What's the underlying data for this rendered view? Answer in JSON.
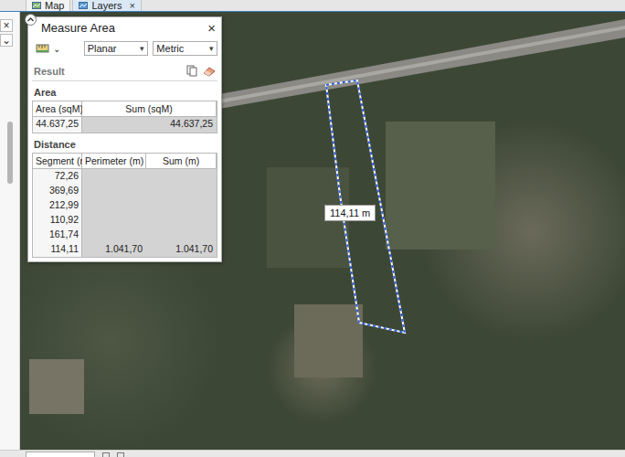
{
  "tabs": [
    {
      "label": "Map",
      "selected": false,
      "close": ""
    },
    {
      "label": "Layers",
      "selected": true,
      "close": "×"
    }
  ],
  "left_strip": {
    "close": "×",
    "dropdown": "⌄"
  },
  "map": {
    "measure_label": "114,11 m"
  },
  "measure_panel": {
    "title": "Measure Area",
    "close": "×",
    "mode_dropdown": "⌄",
    "selects": [
      {
        "value": "Planar",
        "arrow": "▾"
      },
      {
        "value": "Metric",
        "arrow": "▾"
      }
    ],
    "result_label": "Result",
    "area": {
      "heading": "Area",
      "columns": [
        "Area (sqM)",
        "Sum (sqM)"
      ],
      "rows": [
        [
          "44.637,25",
          "44.637,25"
        ]
      ]
    },
    "distance": {
      "heading": "Distance",
      "columns": [
        "Segment (m)",
        "Perimeter (m)",
        "Sum (m)"
      ],
      "rows": [
        [
          "72,26",
          "",
          ""
        ],
        [
          "369,69",
          "",
          ""
        ],
        [
          "212,99",
          "",
          ""
        ],
        [
          "110,92",
          "",
          ""
        ],
        [
          "161,74",
          "",
          ""
        ],
        [
          "114,11",
          "1.041,70",
          "1.041,70"
        ]
      ]
    }
  }
}
